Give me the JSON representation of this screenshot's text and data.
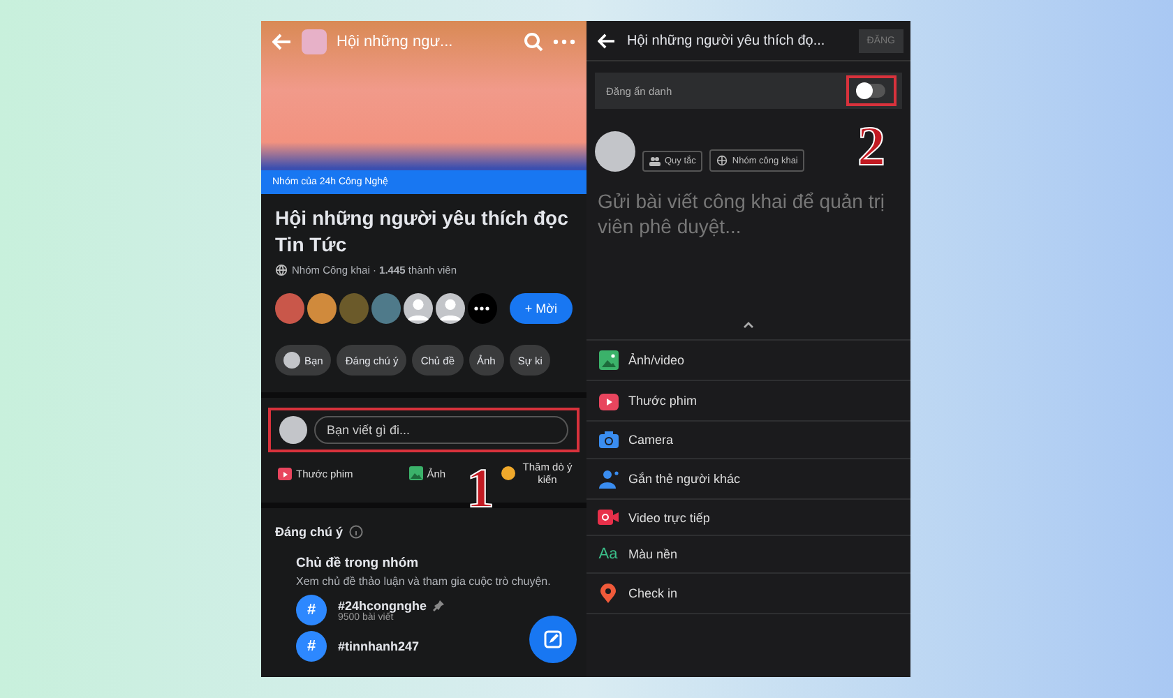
{
  "left": {
    "header_title": "Hội những ngư...",
    "cover_caption": "Nhóm của 24h Công Nghệ",
    "group_name": "Hội những người yêu thích đọc Tin Tức",
    "meta": "Nhóm Công khai · **1.445** thành viên",
    "members": [
      {
        "kind": "photo",
        "color": "#c9574a"
      },
      {
        "kind": "photo",
        "color": "#d08a3c"
      },
      {
        "kind": "photo",
        "color": "#6b5a2a"
      },
      {
        "kind": "photo",
        "color": "#4f7a8a"
      },
      {
        "kind": "blank"
      },
      {
        "kind": "blank"
      },
      {
        "kind": "more"
      }
    ],
    "invite": "+ Mời",
    "chips": [
      {
        "kind": "person",
        "label": "Bạn"
      },
      {
        "kind": "plain",
        "label": "Đáng chú ý"
      },
      {
        "kind": "plain",
        "label": "Chủ đề"
      },
      {
        "kind": "plain",
        "label": "Ảnh"
      },
      {
        "kind": "plain",
        "label": "Sự ki"
      }
    ],
    "composer": {
      "placeholder": "Bạn viết gì đi..."
    },
    "actions": [
      {
        "kind": "reel",
        "label": "Thước phim"
      },
      {
        "kind": "photo",
        "label": "Ảnh"
      },
      {
        "kind": "poll",
        "label": "Thăm dò ý kiến"
      }
    ],
    "annotation": "1",
    "section_title": "Đáng chú ý",
    "card": {
      "title": "Chủ đề trong nhóm",
      "description": "Xem chủ đề thảo luận và tham gia cuộc trò chuyện.",
      "topics": [
        {
          "glyph": "#",
          "name": "#24hcongnghe",
          "count": "9500 bài viết",
          "pinned": true
        },
        {
          "glyph": "#",
          "name": "#tinnhanh247",
          "pinned": false
        }
      ]
    }
  },
  "right": {
    "title": "Hội những người yêu thích đọ...",
    "post_button": {
      "label": "ĐĂNG",
      "disabled": true
    },
    "anonymous": {
      "label": "Đăng ẩn danh",
      "on": false
    },
    "annotation": "2",
    "chips": [
      {
        "kind": "rules",
        "label": "Quy tắc"
      },
      {
        "kind": "public",
        "label": "Nhóm công khai"
      }
    ],
    "placeholder": "Gửi bài viết công khai để quản trị viên phê duyệt...",
    "options": [
      {
        "kind": "photo",
        "label": "Ảnh/video"
      },
      {
        "kind": "reel",
        "label": "Thước phim"
      },
      {
        "kind": "camera",
        "label": "Camera"
      },
      {
        "kind": "tag",
        "label": "Gắn thẻ người khác"
      },
      {
        "kind": "live",
        "label": "Video trực tiếp"
      },
      {
        "kind": "text",
        "glyph": "Aa",
        "label": "Màu nền"
      },
      {
        "kind": "checkin",
        "label": "Check in"
      }
    ]
  }
}
